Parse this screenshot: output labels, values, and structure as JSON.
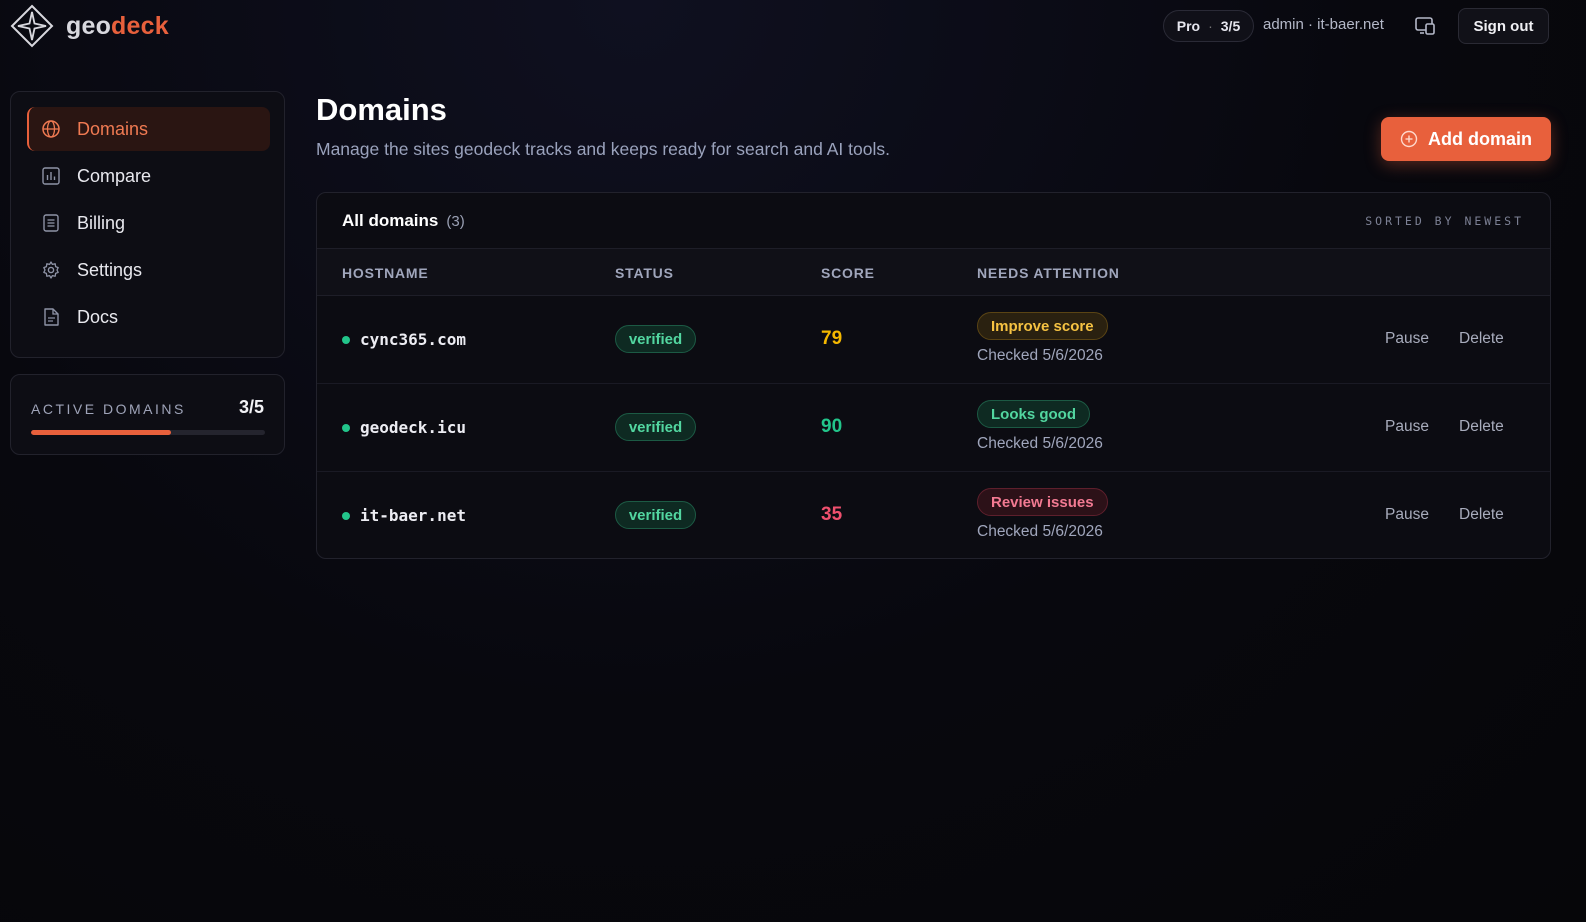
{
  "header": {
    "logo_part1": "geo",
    "logo_part2": "deck",
    "plan_name": "Pro",
    "plan_usage": "3/5",
    "account": "admin · it-baer.net",
    "signout_label": "Sign out"
  },
  "sidebar": {
    "items": [
      {
        "label": "Domains",
        "icon": "globe-icon",
        "active": true
      },
      {
        "label": "Compare",
        "icon": "bar-chart-icon",
        "active": false
      },
      {
        "label": "Billing",
        "icon": "receipt-icon",
        "active": false
      },
      {
        "label": "Settings",
        "icon": "gear-icon",
        "active": false
      },
      {
        "label": "Docs",
        "icon": "document-icon",
        "active": false
      }
    ],
    "quota": {
      "label": "ACTIVE DOMAINS",
      "value": "3/5",
      "fraction": 0.6
    }
  },
  "main": {
    "title": "Domains",
    "subtitle": "Manage the sites geodeck tracks and keeps ready for search and AI tools.",
    "add_label": "Add domain",
    "panel": {
      "title": "All domains",
      "count": "(3)",
      "sort_label": "SORTED BY NEWEST",
      "columns": [
        "HOSTNAME",
        "STATUS",
        "SCORE",
        "NEEDS ATTENTION"
      ],
      "rows": [
        {
          "host": "cync365.com",
          "status": "verified",
          "score": "79",
          "attention": "Improve score",
          "checked": "Checked 5/6/2026",
          "pause": "Pause",
          "delete": "Delete"
        },
        {
          "host": "geodeck.icu",
          "status": "verified",
          "score": "90",
          "attention": "Looks good",
          "checked": "Checked 5/6/2026",
          "pause": "Pause",
          "delete": "Delete"
        },
        {
          "host": "it-baer.net",
          "status": "verified",
          "score": "35",
          "attention": "Review issues",
          "checked": "Checked 5/6/2026",
          "pause": "Pause",
          "delete": "Delete"
        }
      ]
    }
  },
  "colors": {
    "accent": "#e8603c",
    "score_mid": "#f5b800",
    "score_good": "#22c58a",
    "score_bad": "#f0506e",
    "attn_warn_bg": "#2a2110",
    "attn_warn_border": "#5a4414",
    "attn_warn_text": "#f5c242",
    "attn_good_bg": "#0e2a22",
    "attn_good_border": "#1c5a44",
    "attn_good_text": "#52d6a0",
    "attn_bad_bg": "#2c1118",
    "attn_bad_border": "#5e1f2c",
    "attn_bad_text": "#f27a92"
  }
}
